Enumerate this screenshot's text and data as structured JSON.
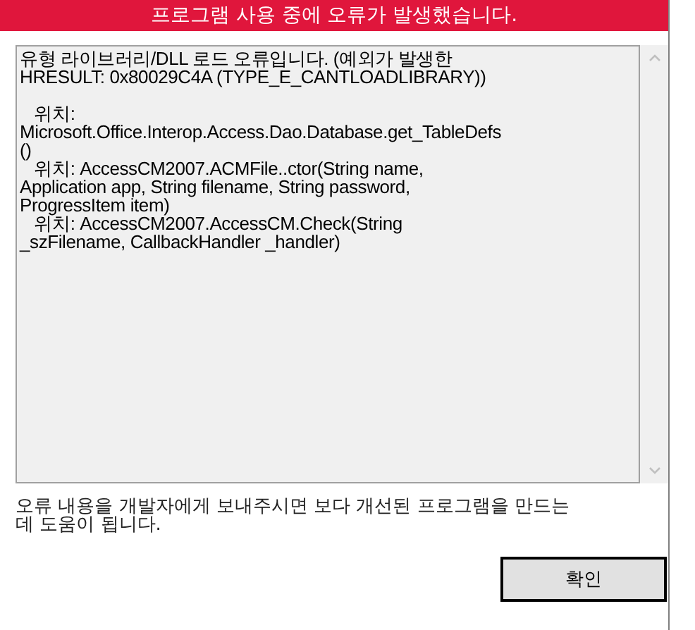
{
  "window": {
    "title": "프로그램 사용 중에 오류가 발생했습니다."
  },
  "error_details": {
    "text": "유형 라이브러리/DLL 로드 오류입니다. (예외가 발생한\nHRESULT: 0x80029C4A (TYPE_E_CANTLOADLIBRARY))\n\n   위치:\nMicrosoft.Office.Interop.Access.Dao.Database.get_TableDefs\n()\n   위치: AccessCM2007.ACMFile..ctor(String name,\nApplication app, String filename, String password,\nProgressItem item)\n   위치: AccessCM2007.AccessCM.Check(String\n_szFilename, CallbackHandler _handler)"
  },
  "message": "오류 내용을 개발자에게 보내주시면 보다 개선된 프로그램을 만드는\n데 도움이 됩니다.",
  "buttons": [
    {
      "label": "확인",
      "default": true
    }
  ]
}
